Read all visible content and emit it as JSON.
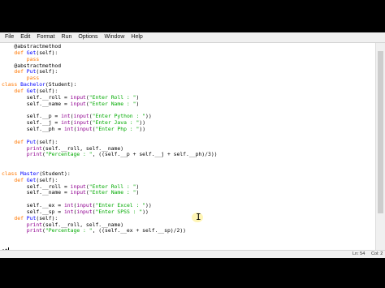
{
  "menu": {
    "items": [
      "File",
      "Edit",
      "Format",
      "Run",
      "Options",
      "Window",
      "Help"
    ]
  },
  "editor": {
    "lines": [
      [
        [
          "    @abstractmethod",
          ""
        ]
      ],
      [
        [
          "    ",
          ""
        ],
        [
          "def",
          "kw"
        ],
        [
          " ",
          ""
        ],
        [
          "Get",
          "df"
        ],
        [
          "(self):",
          ""
        ]
      ],
      [
        [
          "        ",
          ""
        ],
        [
          "pass",
          "kw"
        ]
      ],
      [
        [
          "    @abstractmethod",
          ""
        ]
      ],
      [
        [
          "    ",
          ""
        ],
        [
          "def",
          "kw"
        ],
        [
          " ",
          ""
        ],
        [
          "Put",
          "df"
        ],
        [
          "(self):",
          ""
        ]
      ],
      [
        [
          "        ",
          ""
        ],
        [
          "pass",
          "kw"
        ]
      ],
      [
        [
          "class",
          "kw"
        ],
        [
          " ",
          ""
        ],
        [
          "Bachelor",
          "df"
        ],
        [
          "(Student):",
          ""
        ]
      ],
      [
        [
          "    ",
          ""
        ],
        [
          "def",
          "kw"
        ],
        [
          " ",
          ""
        ],
        [
          "Get",
          "df"
        ],
        [
          "(self):",
          ""
        ]
      ],
      [
        [
          "        self.__roll = ",
          ""
        ],
        [
          "input",
          "bi"
        ],
        [
          "(",
          ""
        ],
        [
          "\"Enter Roll : \"",
          "str"
        ],
        [
          ")",
          ""
        ]
      ],
      [
        [
          "        self.__name = ",
          ""
        ],
        [
          "input",
          "bi"
        ],
        [
          "(",
          ""
        ],
        [
          "\"Enter Name : \"",
          "str"
        ],
        [
          ")",
          ""
        ]
      ],
      [
        [
          "",
          ""
        ]
      ],
      [
        [
          "        self.__p = ",
          ""
        ],
        [
          "int",
          "bi"
        ],
        [
          "(",
          ""
        ],
        [
          "input",
          "bi"
        ],
        [
          "(",
          ""
        ],
        [
          "\"Enter Python : \"",
          "str"
        ],
        [
          "))",
          ""
        ]
      ],
      [
        [
          "        self.__j = ",
          ""
        ],
        [
          "int",
          "bi"
        ],
        [
          "(",
          ""
        ],
        [
          "input",
          "bi"
        ],
        [
          "(",
          ""
        ],
        [
          "\"Enter Java : \"",
          "str"
        ],
        [
          "))",
          ""
        ]
      ],
      [
        [
          "        self.__ph = ",
          ""
        ],
        [
          "int",
          "bi"
        ],
        [
          "(",
          ""
        ],
        [
          "input",
          "bi"
        ],
        [
          "(",
          ""
        ],
        [
          "\"Enter Php : \"",
          "str"
        ],
        [
          "))",
          ""
        ]
      ],
      [
        [
          "",
          ""
        ]
      ],
      [
        [
          "    ",
          ""
        ],
        [
          "def",
          "kw"
        ],
        [
          " ",
          ""
        ],
        [
          "Put",
          "df"
        ],
        [
          "(self):",
          ""
        ]
      ],
      [
        [
          "        ",
          ""
        ],
        [
          "print",
          "bi"
        ],
        [
          "(self.__roll, self.__name)",
          ""
        ]
      ],
      [
        [
          "        ",
          ""
        ],
        [
          "print",
          "bi"
        ],
        [
          "(",
          ""
        ],
        [
          "\"Percentage : \"",
          "str"
        ],
        [
          ", ((self.__p + self.__j + self.__ph)/3))",
          ""
        ]
      ],
      [
        [
          "",
          ""
        ]
      ],
      [
        [
          "",
          ""
        ]
      ],
      [
        [
          "class",
          "kw"
        ],
        [
          " ",
          ""
        ],
        [
          "Master",
          "df"
        ],
        [
          "(Student):",
          ""
        ]
      ],
      [
        [
          "    ",
          ""
        ],
        [
          "def",
          "kw"
        ],
        [
          " ",
          ""
        ],
        [
          "Get",
          "df"
        ],
        [
          "(self):",
          ""
        ]
      ],
      [
        [
          "        self.__roll = ",
          ""
        ],
        [
          "input",
          "bi"
        ],
        [
          "(",
          ""
        ],
        [
          "\"Enter Roll : \"",
          "str"
        ],
        [
          ")",
          ""
        ]
      ],
      [
        [
          "        self.__name = ",
          ""
        ],
        [
          "input",
          "bi"
        ],
        [
          "(",
          ""
        ],
        [
          "\"Enter Name : \"",
          "str"
        ],
        [
          ")",
          ""
        ]
      ],
      [
        [
          "",
          ""
        ]
      ],
      [
        [
          "        self.__ex = ",
          ""
        ],
        [
          "int",
          "bi"
        ],
        [
          "(",
          ""
        ],
        [
          "input",
          "bi"
        ],
        [
          "(",
          ""
        ],
        [
          "\"Enter Excel : \"",
          "str"
        ],
        [
          "))",
          ""
        ]
      ],
      [
        [
          "        self.__sp = ",
          ""
        ],
        [
          "int",
          "bi"
        ],
        [
          "(",
          ""
        ],
        [
          "input",
          "bi"
        ],
        [
          "(",
          ""
        ],
        [
          "\"Enter SPSS : \"",
          "str"
        ],
        [
          "))",
          ""
        ]
      ],
      [
        [
          "    ",
          ""
        ],
        [
          "def",
          "kw"
        ],
        [
          " ",
          ""
        ],
        [
          "Put",
          "df"
        ],
        [
          "(self):",
          ""
        ]
      ],
      [
        [
          "        ",
          ""
        ],
        [
          "print",
          "bi"
        ],
        [
          "(self.__roll, self.__name)",
          ""
        ]
      ],
      [
        [
          "        ",
          ""
        ],
        [
          "print",
          "bi"
        ],
        [
          "(",
          ""
        ],
        [
          "\"Percentage : \"",
          "str"
        ],
        [
          ", ((self.__ex + self.__sp)/2))",
          ""
        ]
      ],
      [
        [
          "",
          ""
        ]
      ],
      [
        [
          "",
          ""
        ]
      ],
      [
        [
          "st",
          ""
        ]
      ]
    ]
  },
  "cursor_line_index": 32,
  "status": {
    "line": "Ln: 54",
    "col": "Col: 2"
  },
  "colors": {
    "keyword": "#ff7700",
    "builtin": "#900090",
    "string": "#00aa00",
    "definition": "#0000ff"
  },
  "icons": {
    "mouse_pointer": "text-ibeam-icon",
    "mouse_glyph": "I"
  }
}
